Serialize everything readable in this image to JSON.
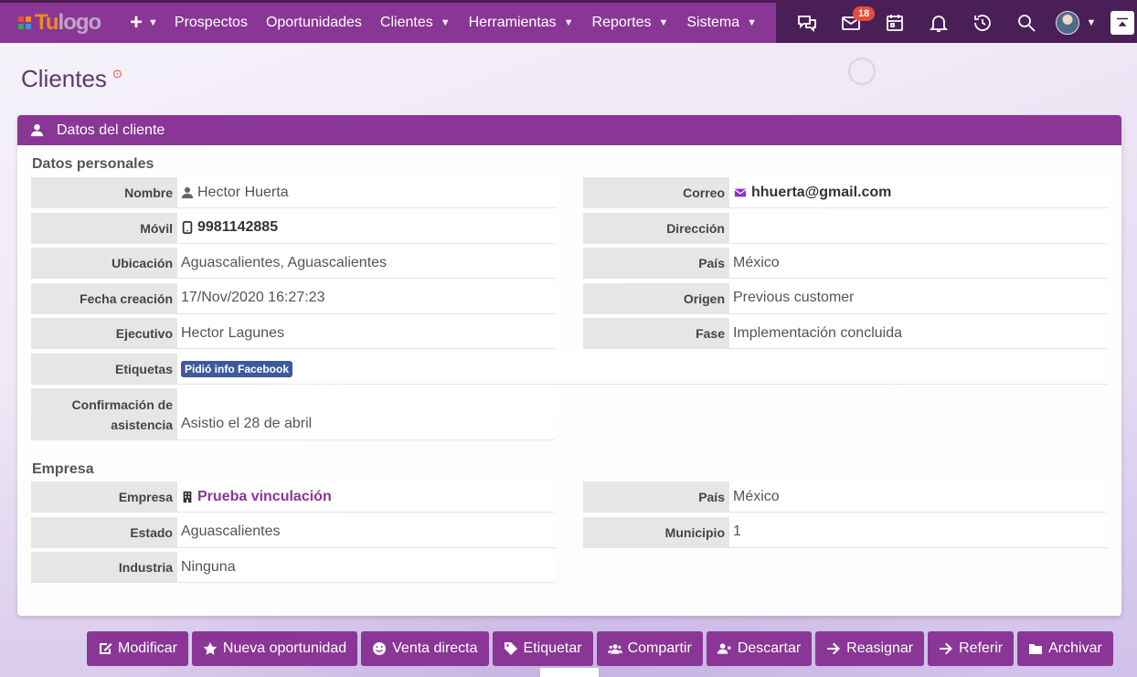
{
  "navbar": {
    "logo_tu": "Tu",
    "logo_text": "logo",
    "plus_label": "+",
    "menu": [
      {
        "label": "Prospectos",
        "dropdown": false
      },
      {
        "label": "Oportunidades",
        "dropdown": false
      },
      {
        "label": "Clientes",
        "dropdown": true
      },
      {
        "label": "Herramientas",
        "dropdown": true
      },
      {
        "label": "Reportes",
        "dropdown": true
      },
      {
        "label": "Sistema",
        "dropdown": true
      }
    ],
    "icons": [
      "chat-icon",
      "mail-icon",
      "calendar-icon",
      "bell-icon",
      "history-icon",
      "search-icon"
    ],
    "mail_badge": "18",
    "colors": {
      "primary": "#8a3696",
      "right_bg": "#4a1f57",
      "badge": "#e74c3c",
      "logo_orange": "#f28c1a"
    }
  },
  "page": {
    "title": "Clientes",
    "help": "?"
  },
  "panel": {
    "header": "Datos del cliente",
    "personal_title": "Datos personales",
    "company_title": "Empresa",
    "personal_left": [
      {
        "label": "Nombre",
        "value": "Hector Huerta"
      },
      {
        "label": "Móvil",
        "value": "9981142885"
      },
      {
        "label": "Ubicación",
        "value": "Aguascalientes, Aguascalientes"
      },
      {
        "label": "Fecha creación",
        "value": "17/Nov/2020 16:27:23"
      },
      {
        "label": "Ejecutivo",
        "value": "Hector Lagunes"
      }
    ],
    "personal_right": [
      {
        "label": "Correo",
        "value": "hhuerta@gmail.com"
      },
      {
        "label": "Dirección",
        "value": ""
      },
      {
        "label": "País",
        "value": "México"
      },
      {
        "label": "Origen",
        "value": "Previous customer"
      },
      {
        "label": "Fase",
        "value": "Implementación concluida"
      }
    ],
    "etiquetas": {
      "label": "Etiquetas",
      "tag": "Pidió info Facebook"
    },
    "confirmacion": {
      "label_line1": "Confirmación de",
      "label_line2": "asistencia",
      "value": "Asistio el 28 de abril"
    },
    "company_left": [
      {
        "label": "Empresa",
        "value": "Prueba vinculación"
      },
      {
        "label": "Estado",
        "value": "Aguascalientes"
      },
      {
        "label": "Industria",
        "value": "Ninguna"
      }
    ],
    "company_right": [
      {
        "label": "País",
        "value": "México"
      },
      {
        "label": "Municipio",
        "value": "1"
      }
    ]
  },
  "actions": [
    {
      "label": "Modificar",
      "icon": "edit-icon"
    },
    {
      "label": "Nueva oportunidad",
      "icon": "star-icon"
    },
    {
      "label": "Venta directa",
      "icon": "smile-icon"
    },
    {
      "label": "Etiquetar",
      "icon": "tag-icon"
    },
    {
      "label": "Compartir",
      "icon": "users-icon"
    },
    {
      "label": "Descartar",
      "icon": "user-times-icon"
    },
    {
      "label": "Reasignar",
      "icon": "arrow-right-icon"
    },
    {
      "label": "Referir",
      "icon": "arrow-right-icon"
    },
    {
      "label": "Archivar",
      "icon": "folder-icon"
    }
  ]
}
